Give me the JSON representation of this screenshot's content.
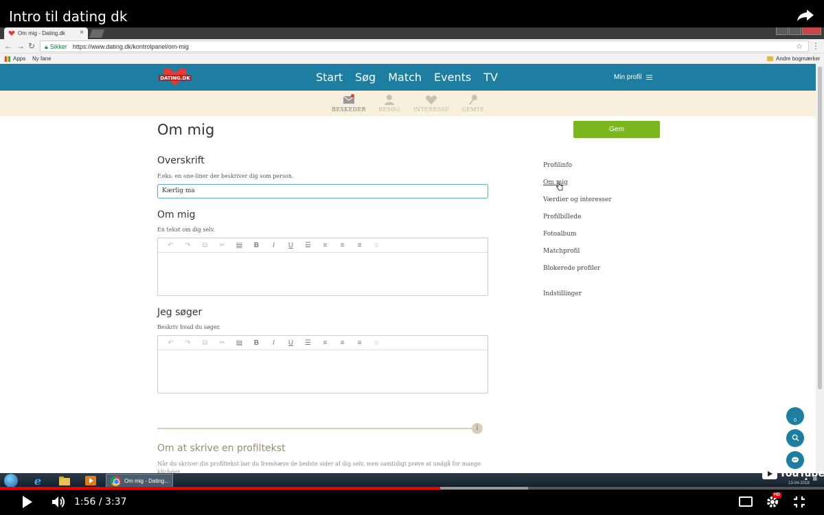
{
  "video": {
    "title": "Intro til dating dk",
    "current_time": "1:56",
    "duration": "3:37",
    "time_display": "1:56 / 3:37",
    "progress_fraction": 0.534,
    "buffered_fraction": 0.641,
    "youtube_logo": "YouTube",
    "hd_label": "HD",
    "date_watermark": "13-04-2018"
  },
  "browser": {
    "tab_title": "Om mig - Dating.dk",
    "secure_label": "Sikker",
    "url": "https://www.dating.dk/kontrolpanel/om-mig",
    "bookmarks": [
      "Apps",
      "Ny fane"
    ],
    "other_bookmarks": "Andre bogmærker"
  },
  "site": {
    "logo_text": "DATING.DK",
    "nav": [
      "Start",
      "Søg",
      "Match",
      "Events",
      "TV"
    ],
    "profile_menu": "Min profil",
    "subnav": [
      {
        "label": "BESKEDER",
        "icon": "envelope-icon",
        "active": true
      },
      {
        "label": "BESØG",
        "icon": "person-icon",
        "active": false
      },
      {
        "label": "INTERESSE",
        "icon": "heart-icon",
        "active": false
      },
      {
        "label": "GEMTE",
        "icon": "pin-icon",
        "active": false
      }
    ],
    "accent_color": "#1e7ea1",
    "save_color": "#7bb820"
  },
  "form": {
    "page_title": "Om mig",
    "save_label": "Gem",
    "headline": {
      "title": "Overskrift",
      "help": "F.eks. en one-liner der beskriver dig som person.",
      "value": "Kærlig ma"
    },
    "about": {
      "title": "Om mig",
      "help": "En tekst om dig selv."
    },
    "seeking": {
      "title": "Jeg søger",
      "help": "Beskriv hvad du søger."
    },
    "tips_title": "Om at skrive en profiltekst",
    "tips_body": "Når du skriver din profiltekst bør du fremhæve de bedste sider af dig selv, men samtidigt prøve at undgå for mange klichéer."
  },
  "sidebar": {
    "links": [
      "Profilinfo",
      "Om mig",
      "Værdier og interesser",
      "Profilbillede",
      "Fotoalbum",
      "Matchprofil",
      "Blokerede profiler",
      "Indstillinger"
    ],
    "active": "Om mig"
  },
  "floating": {
    "pin_count": "0"
  },
  "taskbar": {
    "active_item": "Om mig - Dating..."
  }
}
